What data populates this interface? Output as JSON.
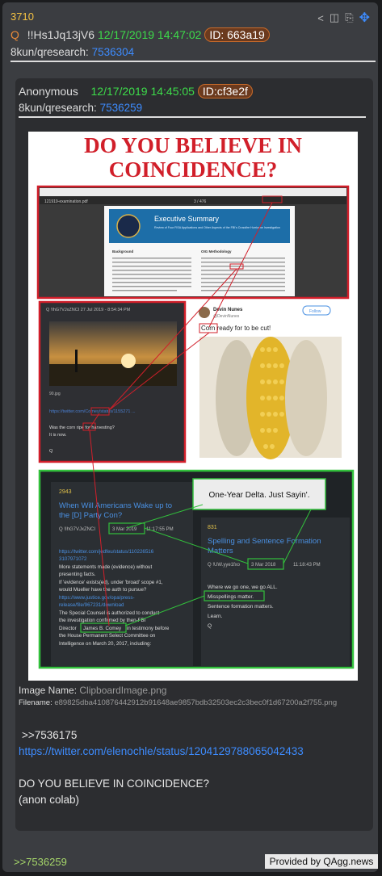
{
  "post": {
    "number": "3710",
    "q_mark": "Q",
    "tripcode": "!!Hs1Jq13jV6",
    "datetime": "12/17/2019 14:47:02",
    "id_badge": "ID: 663a19",
    "board": "8kun/qresearch:",
    "board_link": "7536304"
  },
  "quoted": {
    "author": "Anonymous",
    "datetime": "12/17/2019 14:45:05",
    "id_badge": "ID:cf3e2f",
    "board": "8kun/qresearch:",
    "board_link": "7536259",
    "image_name_label": "Image Name:",
    "image_name": "ClipboardImage.png",
    "filename_label": "Filename:",
    "filename": "e89825dba410876442912b91648ae9857bdb32503ec2c3bec0f1d67200a2f755.png",
    "body_ref": ">>7536175",
    "body_url": "https://twitter.com/elenochle/status/1204129788065042433",
    "body_line1": "DO YOU BELIEVE IN COINCIDENCE?",
    "body_line2": "(anon colab)"
  },
  "image": {
    "title_line1": "DO YOU BELIEVE IN",
    "title_line2": "COINCIDENCE?",
    "browser_tab": "121919-examination.pdf",
    "browser_page": "3 / 476",
    "exec_title": "Executive Summary",
    "exec_sub": "Review of Four FISA Applications and Other Aspects of the FBI's Crossfire Hurricane Investigation",
    "background_label": "Background",
    "oig_label": "OIG Methodology",
    "tweet_handle": "Q !IhG7VJxZNCI 27 Jul 2019 - 8:54:34 PM",
    "tweet_file": "90.jpg",
    "tweet_link": "https://twitter.com/Comey/status/1155271 ...",
    "tweet_text": "Was the corn ripe for harvesting?",
    "tweet_text2": "It is now.",
    "tweet_q": "Q",
    "nunes_name": "Devin Nunes",
    "nunes_handle": "@DevinNunes",
    "nunes_follow": "Follow",
    "nunes_text": "Corn ready for to be cut!",
    "delta_label": "One-Year Delta. Just Sayin'.",
    "post_num": "2943",
    "post_title": "When Will Americans Wake up to the [D] Party Con?",
    "post_date": "3 Mar 2019",
    "post_time": "11:17:55 PM",
    "post_body": "https://twitter.com/jedfeu/status/11022651631 More statements made (evidence) without presenting facts. If 'evidence' exists(ed), under 'broad' scope #1, would Mueller have the auth to pursue? https://www.justice.gov/opa/press-release/file/967231/download The Special Counsel is authorized to conduct the investigation confirmed by then-FBI Director",
    "post_highlight": "James B. Comey",
    "post_body2": "in testimony before the House Permanent Select Committee on Intelligence on March 20, 2017, including:",
    "post2_num": "831",
    "post2_title": "Spelling and Sentence Formation Matters",
    "post2_date": "3 Mar 2018",
    "post2_time": "11:18:43 PM",
    "post2_line1": "Where we go one, we go ALL.",
    "post2_highlight": "Misspellings matter.",
    "post2_line2": "Sentence formation matters.",
    "post2_line3": "Learn.",
    "post2_q": "Q",
    "post_handle": "Q !IhG7VJxZNCI",
    "post2_handle": "Q !UW.yye1fxo"
  },
  "footer": {
    "reply_link": ">>7536259",
    "provided_by": "Provided by QAgg.news"
  },
  "colors": {
    "accent_blue": "#3d8cff",
    "date_green": "#3ddc4a",
    "number_yellow": "#f5c242",
    "highlight_red": "#d11f2a",
    "highlight_green": "#32c03c"
  }
}
